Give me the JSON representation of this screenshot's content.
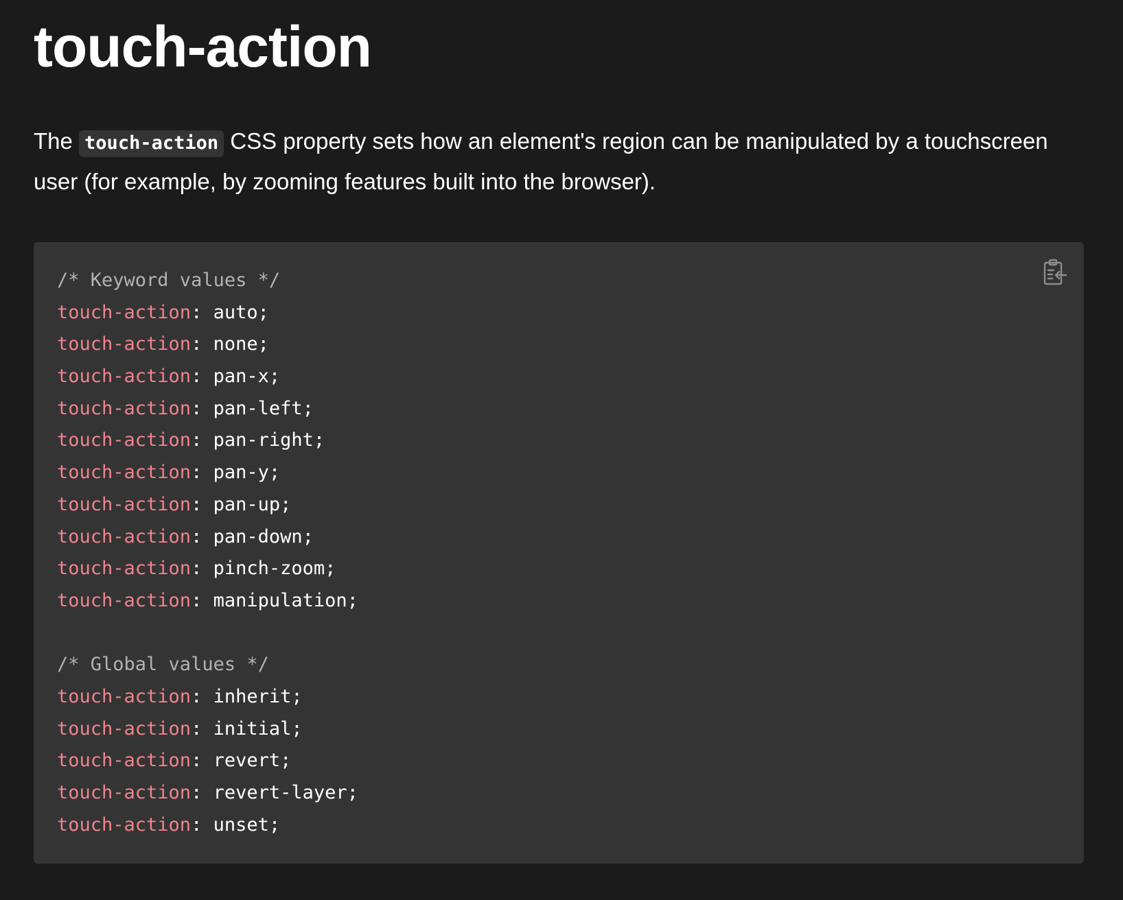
{
  "page_title": "touch-action",
  "intro": {
    "before": "The ",
    "code": "touch-action",
    "after": " CSS property sets how an element's region can be manipulated by a touchscreen user (for example, by zooming features built into the browser)."
  },
  "code_block": {
    "copy_icon": "clipboard-copy-icon",
    "lines": [
      {
        "type": "comment",
        "text": "/* Keyword values */"
      },
      {
        "type": "decl",
        "prop": "touch-action",
        "value": "auto"
      },
      {
        "type": "decl",
        "prop": "touch-action",
        "value": "none"
      },
      {
        "type": "decl",
        "prop": "touch-action",
        "value": "pan-x"
      },
      {
        "type": "decl",
        "prop": "touch-action",
        "value": "pan-left"
      },
      {
        "type": "decl",
        "prop": "touch-action",
        "value": "pan-right"
      },
      {
        "type": "decl",
        "prop": "touch-action",
        "value": "pan-y"
      },
      {
        "type": "decl",
        "prop": "touch-action",
        "value": "pan-up"
      },
      {
        "type": "decl",
        "prop": "touch-action",
        "value": "pan-down"
      },
      {
        "type": "decl",
        "prop": "touch-action",
        "value": "pinch-zoom"
      },
      {
        "type": "decl",
        "prop": "touch-action",
        "value": "manipulation"
      },
      {
        "type": "blank"
      },
      {
        "type": "comment",
        "text": "/* Global values */"
      },
      {
        "type": "decl",
        "prop": "touch-action",
        "value": "inherit"
      },
      {
        "type": "decl",
        "prop": "touch-action",
        "value": "initial"
      },
      {
        "type": "decl",
        "prop": "touch-action",
        "value": "revert"
      },
      {
        "type": "decl",
        "prop": "touch-action",
        "value": "revert-layer"
      },
      {
        "type": "decl",
        "prop": "touch-action",
        "value": "unset"
      }
    ]
  },
  "colors": {
    "background": "#1b1b1b",
    "code_background": "#343434",
    "property": "#f0838e",
    "comment": "#b3b3b3",
    "text": "#ffffff"
  }
}
